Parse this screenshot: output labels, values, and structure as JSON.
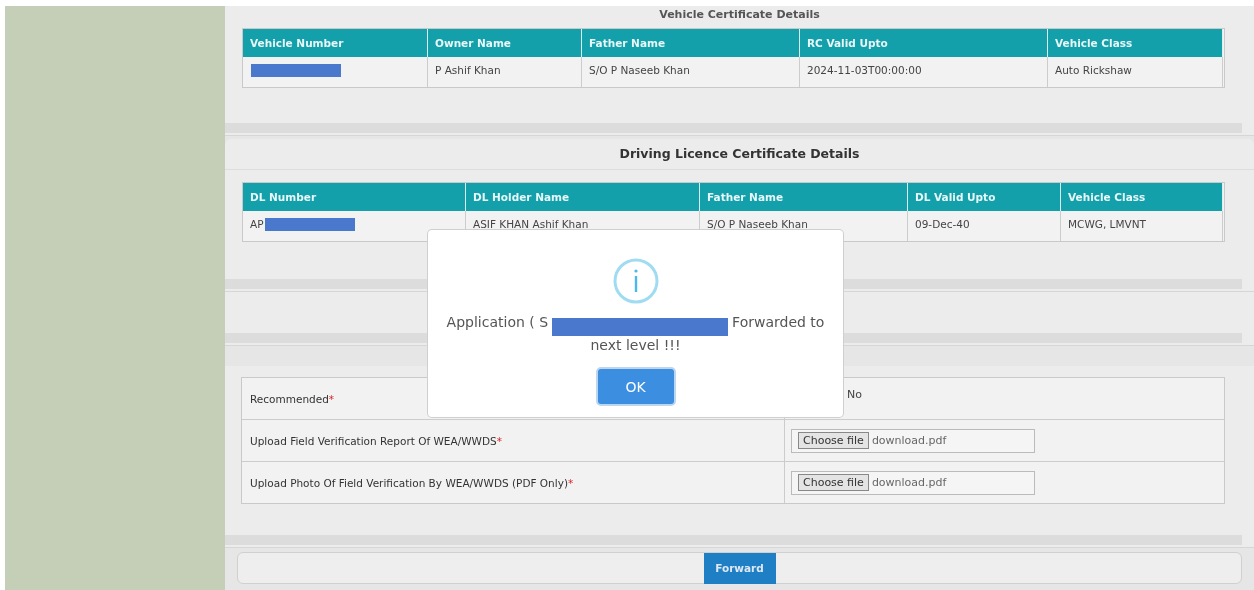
{
  "vehicle_section": {
    "title": "Vehicle Certificate Details",
    "columns": [
      "Vehicle Number",
      "Owner Name",
      "Father Name",
      "RC Valid Upto",
      "Vehicle Class"
    ],
    "rows": [
      {
        "cells": [
          "",
          "P Ashif Khan",
          "S/O P Naseeb Khan",
          "2024-11-03T00:00:00",
          "Auto Rickshaw"
        ],
        "redacted": true
      }
    ]
  },
  "dl_section": {
    "title": "Driving Licence Certificate Details",
    "columns": [
      "DL Number",
      "DL Holder Name",
      "Father Name",
      "DL Valid Upto",
      "Vehicle Class"
    ],
    "rows": [
      {
        "cells": [
          "AP",
          "ASIF KHAN Ashif Khan",
          "S/O P Naseeb Khan",
          "09-Dec-40",
          "MCWG, LMVNT"
        ],
        "redacted": true
      }
    ]
  },
  "form": {
    "rows": [
      {
        "kind": "radio",
        "label": "Recommended",
        "mark": "*",
        "option": "No"
      },
      {
        "kind": "file",
        "label": "Upload Field Verification Report Of WEA/WWDS",
        "mark": "*",
        "button": "Choose file",
        "file": "download.pdf"
      },
      {
        "kind": "file",
        "label": "Upload Photo Of Field Verification By WEA/WWDS (PDF Only)",
        "mark": "*",
        "button": "Choose file",
        "file": "download.pdf"
      }
    ]
  },
  "footer": {
    "button": "Forward"
  },
  "dialog": {
    "before": "Application ( S",
    "after": "Forwarded to next level !!!",
    "button": "OK"
  }
}
